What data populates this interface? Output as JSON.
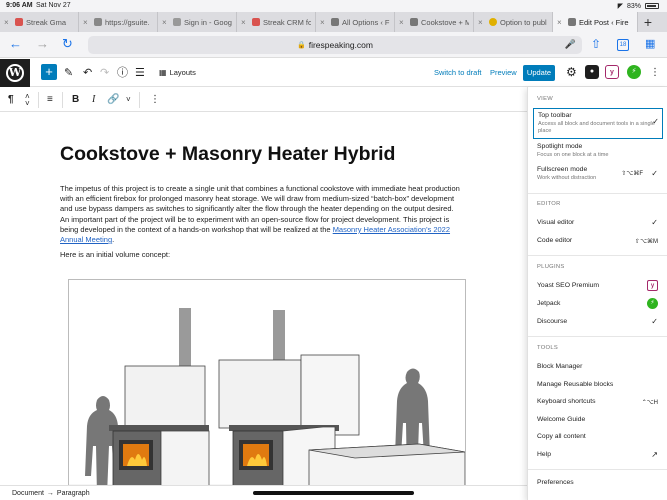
{
  "status": {
    "time": "9:06 AM",
    "date": "Sat Nov 27",
    "battery": "83%"
  },
  "tabs": [
    {
      "label": "Streak Gma",
      "favicon_color": "#d9534f"
    },
    {
      "label": "https://gsuite.",
      "favicon_color": "#777777"
    },
    {
      "label": "Sign in - Goog",
      "favicon_color": "#888888"
    },
    {
      "label": "Streak CRM fo",
      "favicon_color": "#d9534f"
    },
    {
      "label": "All Options ‹ F",
      "favicon_color": "#555555"
    },
    {
      "label": "Cookstove + M",
      "favicon_color": "#555555"
    },
    {
      "label": "Option to publ",
      "favicon_color": "#e0b000"
    },
    {
      "label": "Edit Post ‹ Fire",
      "favicon_color": "#555555",
      "active": true
    }
  ],
  "browser": {
    "url": "firespeaking.com",
    "tab_count": "18"
  },
  "wp": {
    "layouts_label": "Layouts",
    "switch_to_draft": "Switch to draft",
    "preview": "Preview",
    "update": "Update",
    "accent": "#007cba"
  },
  "post": {
    "title": "Cookstove + Masonry Heater Hybrid",
    "intro_text": "The impetus of this project is to create a single unit that combines a functional cookstove with immediate heat production with an efficient firebox for prolonged masonry heat storage. We will draw from medium-sized “batch-box” development and use bypass dampers as switches to significantly alter the flow through the heater depending on the output desired.  An important part of the project will be to experiment with an open-source flow for project development.  This project is being developed in the context of a hands-on workshop that will be realized at the ",
    "intro_link": "Masonry Heater Association's 2022 Annual Meeting",
    "intro_end": ".",
    "initial_concept": "Here is an initial volume concept:"
  },
  "breadcrumb": {
    "document": "Document",
    "arrow": "→",
    "paragraph": "Paragraph"
  },
  "options": {
    "view_heading": "VIEW",
    "top_toolbar": "Top toolbar",
    "top_toolbar_desc": "Access all block and document tools in a single place",
    "spotlight": "Spotlight mode",
    "spotlight_desc": "Focus on one block at a time",
    "fullscreen": "Fullscreen mode",
    "fullscreen_desc": "Work without distraction",
    "fullscreen_shortcut": "⇧⌥⌘F",
    "editor_heading": "EDITOR",
    "visual_editor": "Visual editor",
    "code_editor": "Code editor",
    "code_editor_shortcut": "⇧⌥⌘M",
    "plugins_heading": "PLUGINS",
    "yoast": "Yoast SEO Premium",
    "jetpack": "Jetpack",
    "discourse": "Discourse",
    "tools_heading": "TOOLS",
    "block_manager": "Block Manager",
    "manage_reusable": "Manage Reusable blocks",
    "keyboard_shortcuts": "Keyboard shortcuts",
    "keyboard_shortcut_key": "⌃⌥H",
    "welcome_guide": "Welcome Guide",
    "copy_all": "Copy all content",
    "help": "Help",
    "preferences": "Preferences"
  }
}
